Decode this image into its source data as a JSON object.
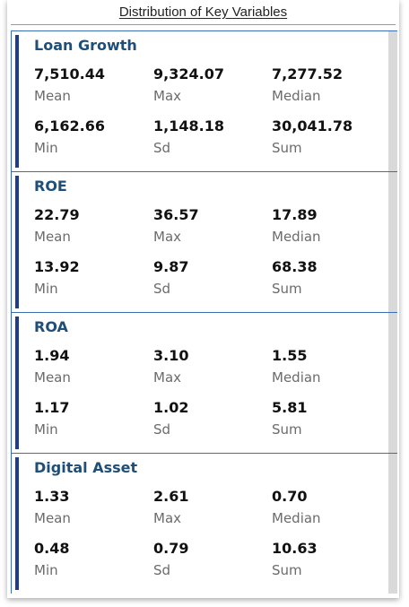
{
  "title": "Distribution of Key Variables",
  "cards": [
    {
      "name": "Loan Growth",
      "stats": [
        {
          "value": "7,510.44",
          "label": "Mean"
        },
        {
          "value": "9,324.07",
          "label": "Max"
        },
        {
          "value": "7,277.52",
          "label": "Median"
        },
        {
          "value": "6,162.66",
          "label": "Min"
        },
        {
          "value": "1,148.18",
          "label": "Sd"
        },
        {
          "value": "30,041.78",
          "label": "Sum"
        }
      ]
    },
    {
      "name": "ROE",
      "stats": [
        {
          "value": "22.79",
          "label": "Mean"
        },
        {
          "value": "36.57",
          "label": "Max"
        },
        {
          "value": "17.89",
          "label": "Median"
        },
        {
          "value": "13.92",
          "label": "Min"
        },
        {
          "value": "9.87",
          "label": "Sd"
        },
        {
          "value": "68.38",
          "label": "Sum"
        }
      ]
    },
    {
      "name": "ROA",
      "stats": [
        {
          "value": "1.94",
          "label": "Mean"
        },
        {
          "value": "3.10",
          "label": "Max"
        },
        {
          "value": "1.55",
          "label": "Median"
        },
        {
          "value": "1.17",
          "label": "Min"
        },
        {
          "value": "1.02",
          "label": "Sd"
        },
        {
          "value": "5.81",
          "label": "Sum"
        }
      ]
    },
    {
      "name": "Digital Asset",
      "stats": [
        {
          "value": "1.33",
          "label": "Mean"
        },
        {
          "value": "2.61",
          "label": "Max"
        },
        {
          "value": "0.70",
          "label": "Median"
        },
        {
          "value": "0.48",
          "label": "Min"
        },
        {
          "value": "0.79",
          "label": "Sd"
        },
        {
          "value": "10.63",
          "label": "Sum"
        }
      ]
    }
  ],
  "colors": {
    "accent_bar": "#1f3d8a",
    "card_border": "#3a6fb5",
    "card_title": "#1f4e79",
    "scrollbar": "#d9d9d9"
  }
}
